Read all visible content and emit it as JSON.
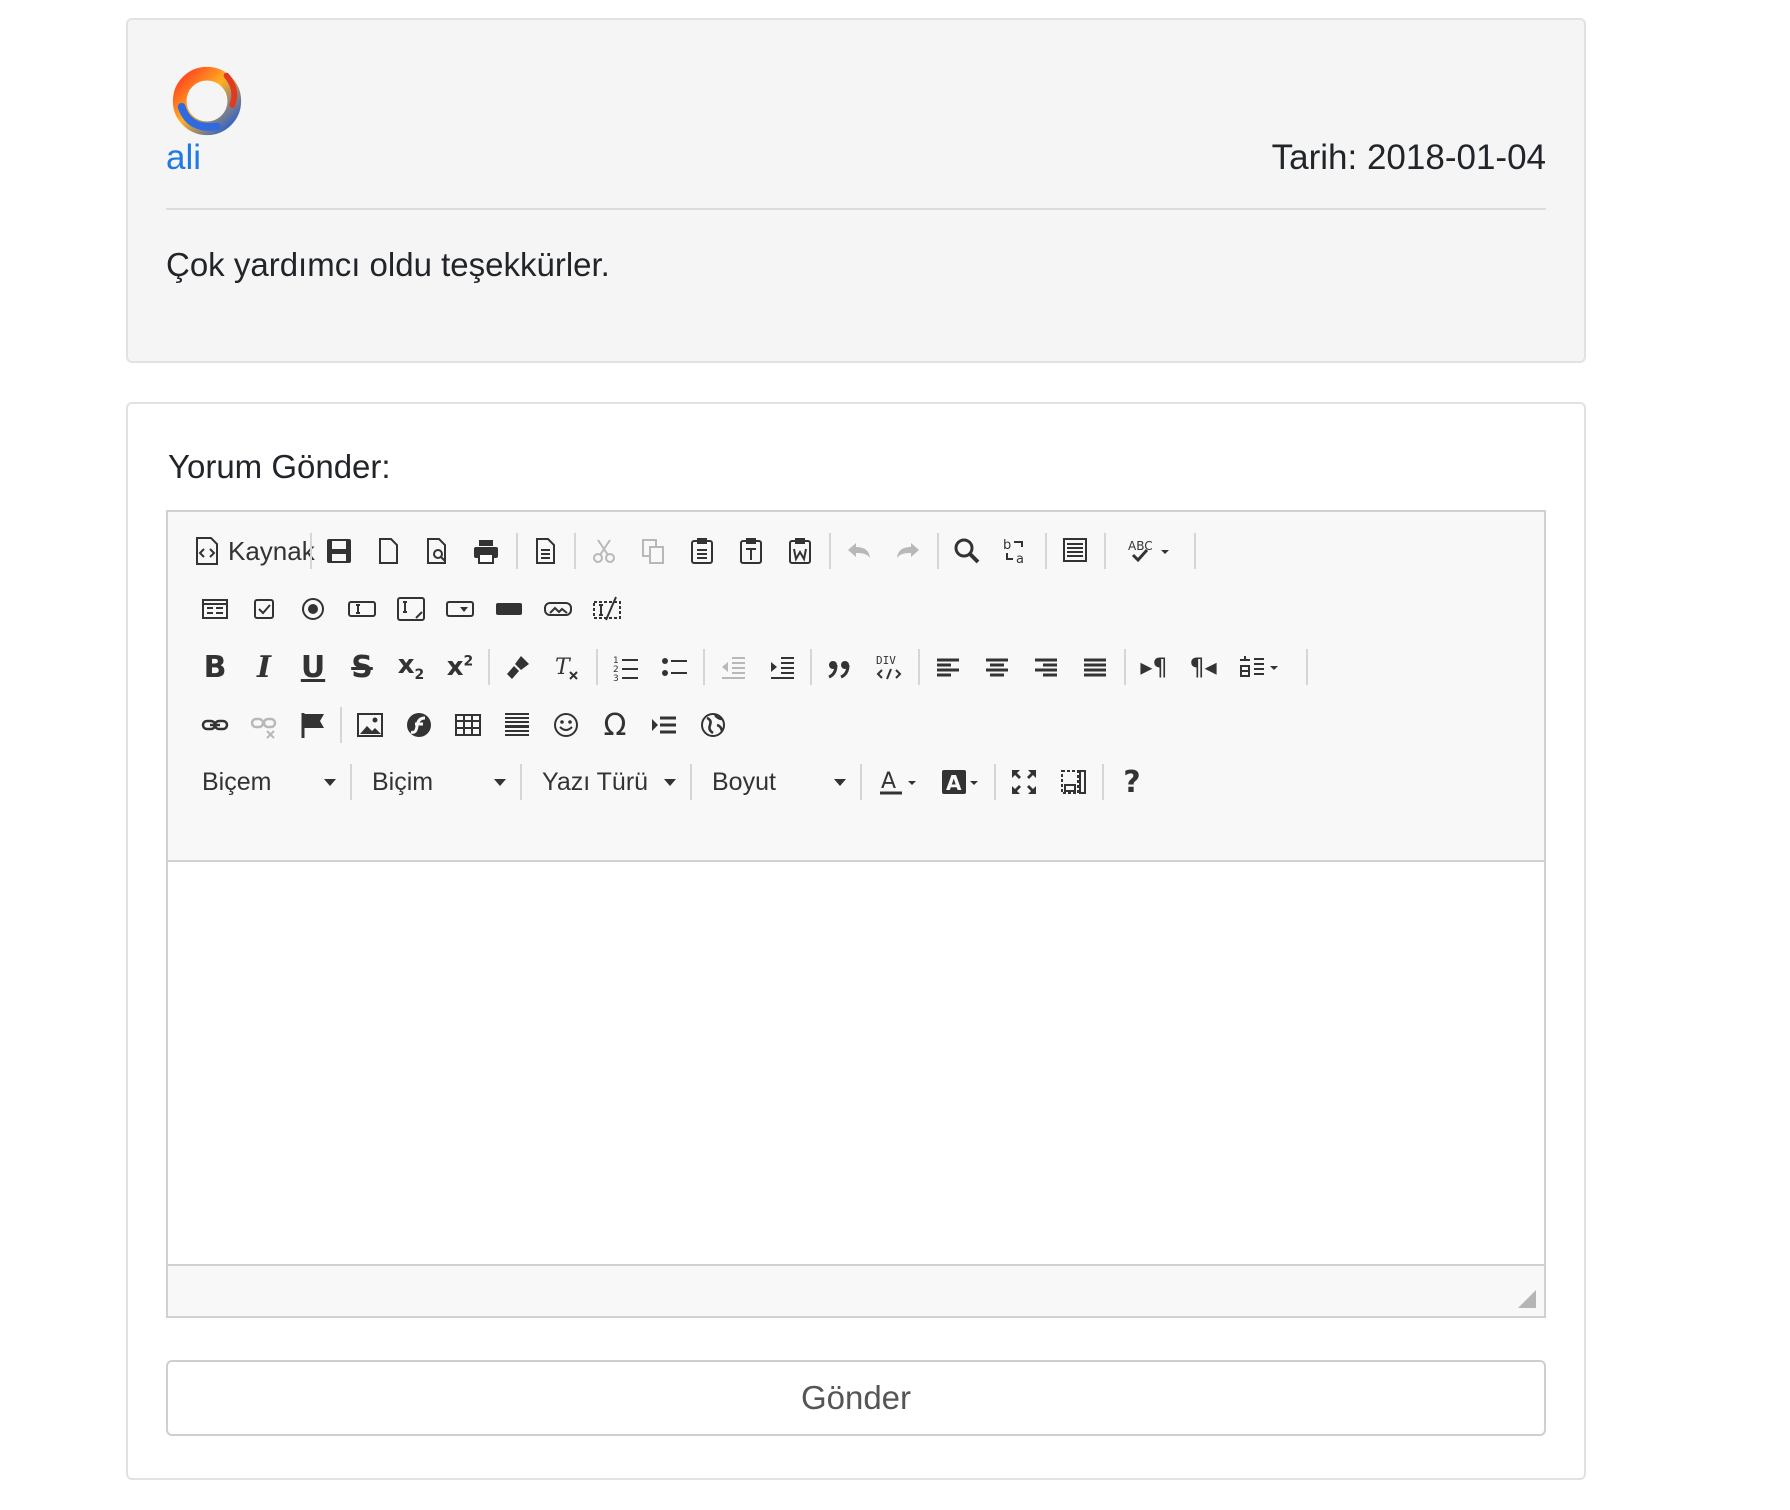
{
  "comment": {
    "author": "ali",
    "date_label": "Tarih: 2018-01-04",
    "text": "Çok yardımcı oldu teşekkürler."
  },
  "form": {
    "title": "Yorum Gönder:",
    "submit_label": "Gönder"
  },
  "editor": {
    "source_label": "Kaynak",
    "combos": {
      "styles": "Biçem",
      "format": "Biçim",
      "font": "Yazı Türü",
      "size": "Boyut"
    },
    "help_glyph": "?"
  },
  "colors": {
    "link": "#1f7be0",
    "comment_bg": "#f5f5f5",
    "toolbar_bg": "#f8f8f8"
  }
}
